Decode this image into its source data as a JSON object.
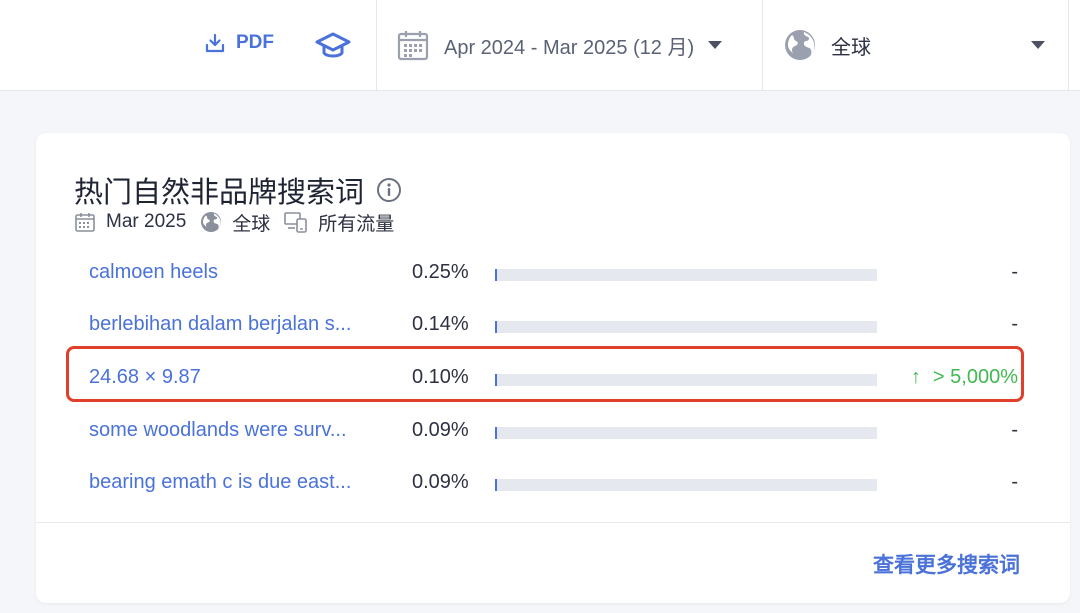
{
  "toolbar": {
    "pdf_label": "PDF",
    "date_range": "Apr 2024 - Mar 2025 (12 月)",
    "region": "全球"
  },
  "card": {
    "title": "热门自然非品牌搜索词",
    "meta": {
      "month": "Mar 2025",
      "region": "全球",
      "traffic": "所有流量"
    },
    "rows": [
      {
        "term": "calmoen heels",
        "share": "0.25%",
        "fill": 0.25,
        "change": "-"
      },
      {
        "term": "berlebihan dalam berjalan s...",
        "share": "0.14%",
        "fill": 0.14,
        "change": "-"
      },
      {
        "term": "24.68 × 9.87",
        "share": "0.10%",
        "fill": 0.1,
        "change": "> 5,000%"
      },
      {
        "term": "some woodlands were surv...",
        "share": "0.09%",
        "fill": 0.09,
        "change": "-"
      },
      {
        "term": "bearing emath c is due east...",
        "share": "0.09%",
        "fill": 0.09,
        "change": "-"
      }
    ],
    "more_link": "查看更多搜索词"
  },
  "colors": {
    "accent": "#4a72d9",
    "positive": "#3fb950",
    "highlight": "#e03f2a"
  },
  "icons": [
    "download-icon",
    "graduation-cap-icon",
    "calendar-icon",
    "globe-icon",
    "info-icon",
    "devices-icon",
    "up-arrow-icon",
    "caret-down-icon"
  ]
}
